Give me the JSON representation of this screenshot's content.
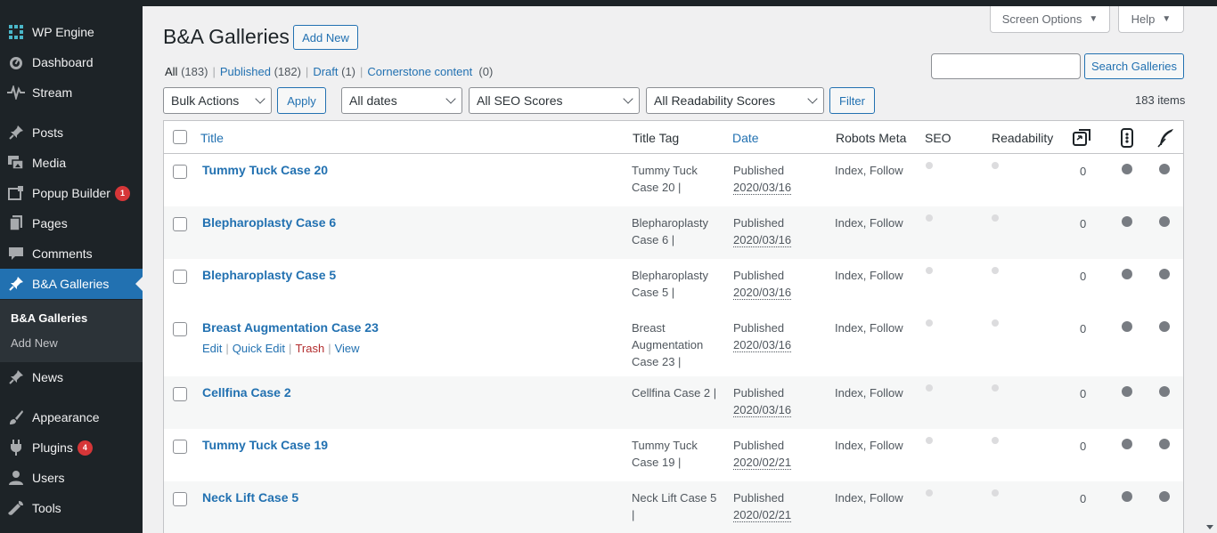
{
  "sidebar": {
    "items": [
      {
        "label": "WP Engine",
        "icon": "grid-icon"
      },
      {
        "label": "Dashboard",
        "icon": "dashboard-icon"
      },
      {
        "label": "Stream",
        "icon": "stream-icon"
      },
      {
        "label": "Posts",
        "icon": "pin-icon"
      },
      {
        "label": "Media",
        "icon": "media-icon"
      },
      {
        "label": "Popup Builder",
        "icon": "popup-icon",
        "badge": "1"
      },
      {
        "label": "Pages",
        "icon": "pages-icon"
      },
      {
        "label": "Comments",
        "icon": "comments-icon"
      },
      {
        "label": "B&A Galleries",
        "icon": "pin-icon"
      },
      {
        "label": "News",
        "icon": "pin-icon"
      },
      {
        "label": "Appearance",
        "icon": "brush-icon"
      },
      {
        "label": "Plugins",
        "icon": "plugin-icon",
        "badge": "4"
      },
      {
        "label": "Users",
        "icon": "user-icon"
      },
      {
        "label": "Tools",
        "icon": "wrench-icon"
      }
    ],
    "submenu": {
      "current": "B&A Galleries",
      "add_new": "Add New"
    }
  },
  "header": {
    "screen_options": "Screen Options",
    "help": "Help",
    "title": "B&A Galleries",
    "add_new": "Add New"
  },
  "filters_links": {
    "all": "All",
    "all_count": "(183)",
    "published": "Published",
    "published_count": "(182)",
    "draft": "Draft",
    "draft_count": "(1)",
    "cornerstone": "Cornerstone content",
    "cornerstone_count": "(0)",
    "sep": "|"
  },
  "search": {
    "button": "Search Galleries",
    "value": ""
  },
  "toolbar": {
    "bulk_actions": "Bulk Actions",
    "apply": "Apply",
    "dates": "All dates",
    "seo": "All SEO Scores",
    "readability": "All Readability Scores",
    "filter": "Filter",
    "items": "183 items"
  },
  "columns": {
    "title": "Title",
    "title_tag": "Title Tag",
    "date": "Date",
    "robots": "Robots Meta",
    "seo": "SEO",
    "readability": "Readability",
    "links_icon": "outgoing-links-icon",
    "internal_icon": "internal-links-icon",
    "feather_icon": "feather-icon"
  },
  "row_actions": {
    "edit": "Edit",
    "quick_edit": "Quick Edit",
    "trash": "Trash",
    "view": "View",
    "sep": "|"
  },
  "rows": [
    {
      "title": "Tummy Tuck Case 20",
      "tag1": "Tummy Tuck",
      "tag2": "Case 20 |",
      "tag3": "",
      "status": "Published",
      "date": "2020/03/16",
      "robots": "Index, Follow",
      "links": "0"
    },
    {
      "title": "Blepharoplasty Case 6",
      "tag1": "Blepharoplasty",
      "tag2": "Case 6 |",
      "tag3": "",
      "status": "Published",
      "date": "2020/03/16",
      "robots": "Index, Follow",
      "links": "0"
    },
    {
      "title": "Blepharoplasty Case 5",
      "tag1": "Blepharoplasty",
      "tag2": "Case 5 |",
      "tag3": "",
      "status": "Published",
      "date": "2020/03/16",
      "robots": "Index, Follow",
      "links": "0"
    },
    {
      "title": "Breast Augmentation Case 23",
      "tag1": "Breast",
      "tag2": "Augmentation",
      "tag3": "Case 23 |",
      "status": "Published",
      "date": "2020/03/16",
      "robots": "Index, Follow",
      "links": "0"
    },
    {
      "title": "Cellfina Case 2",
      "tag1": "Cellfina Case 2 |",
      "tag2": "",
      "tag3": "",
      "status": "Published",
      "date": "2020/03/16",
      "robots": "Index, Follow",
      "links": "0"
    },
    {
      "title": "Tummy Tuck Case 19",
      "tag1": "Tummy Tuck",
      "tag2": "Case 19 |",
      "tag3": "",
      "status": "Published",
      "date": "2020/02/21",
      "robots": "Index, Follow",
      "links": "0"
    },
    {
      "title": "Neck Lift Case 5",
      "tag1": "Neck Lift Case 5",
      "tag2": "|",
      "tag3": "",
      "status": "Published",
      "date": "2020/02/21",
      "robots": "Index, Follow",
      "links": "0"
    }
  ],
  "colors": {
    "accent": "#2271b1",
    "sidebar": "#1d2327",
    "active": "#2271b1",
    "badge": "#d63638",
    "trash": "#b32d2e"
  }
}
